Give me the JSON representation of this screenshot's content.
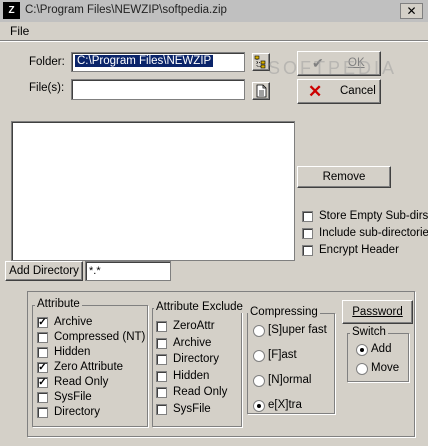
{
  "window": {
    "title": "C:\\Program Files\\NEWZIP\\softpedia.zip",
    "close_glyph": "✕",
    "icon_glyph": "Z"
  },
  "menu": {
    "file": "File"
  },
  "form": {
    "folder_label": "Folder:",
    "folder_value": "C:\\Program Files\\NEWZIP",
    "files_label": "File(s):",
    "files_value": ""
  },
  "buttons": {
    "ok": "OK",
    "cancel": "Cancel",
    "remove": "Remove",
    "add_directory": "Add Directory",
    "password": "Password"
  },
  "options": {
    "store_empty": "Store Empty Sub-dirs",
    "include_sub": "Include sub-directories",
    "encrypt": "Encrypt Header"
  },
  "filter_value": "*.*",
  "attribute": {
    "title": "Attribute",
    "items": [
      {
        "label": "Archive",
        "checked": true
      },
      {
        "label": "Compressed (NT)",
        "checked": false
      },
      {
        "label": "Hidden",
        "checked": false
      },
      {
        "label": "Zero Attribute",
        "checked": true
      },
      {
        "label": "Read Only",
        "checked": true
      },
      {
        "label": "SysFile",
        "checked": false
      },
      {
        "label": "Directory",
        "checked": false
      }
    ]
  },
  "attribute_exclude": {
    "title": "Attribute Exclude",
    "items": [
      {
        "label": "ZeroAttr",
        "checked": false
      },
      {
        "label": "Archive",
        "checked": false
      },
      {
        "label": "Directory",
        "checked": false
      },
      {
        "label": "Hidden",
        "checked": false
      },
      {
        "label": "Read Only",
        "checked": false
      },
      {
        "label": "SysFile",
        "checked": false
      }
    ]
  },
  "compressing": {
    "title": "Compressing",
    "items": [
      {
        "label": "[S]uper fast",
        "selected": false
      },
      {
        "label": "[F]ast",
        "selected": false
      },
      {
        "label": "[N]ormal",
        "selected": false
      },
      {
        "label": "e[X]tra",
        "selected": true
      }
    ]
  },
  "switch": {
    "title": "Switch",
    "items": [
      {
        "label": "Add",
        "selected": true
      },
      {
        "label": "Move",
        "selected": false
      }
    ]
  },
  "watermark": "SOFTPEDIA",
  "colors": {
    "selection": "#0a246a",
    "face": "#d4d0c8",
    "cancel_red": "#cc0000"
  }
}
